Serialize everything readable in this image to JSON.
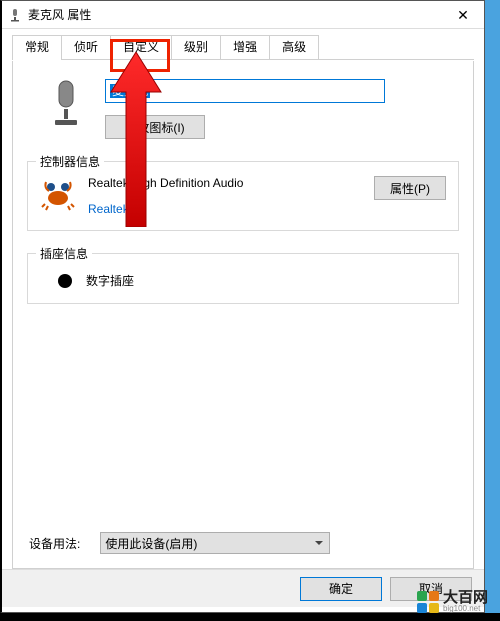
{
  "window": {
    "title": "麦克风 属性",
    "close": "✕"
  },
  "tabs": {
    "t0": "常规",
    "t1": "侦听",
    "t2": "自定义",
    "t3": "级别",
    "t4": "增强",
    "t5": "高级"
  },
  "device_name": "麦克风",
  "change_icon_btn": "更改图标(I)",
  "controller": {
    "legend": "控制器信息",
    "name": "Realtek High Definition Audio",
    "vendor": "Realtek",
    "properties_btn": "属性(P)"
  },
  "jack": {
    "legend": "插座信息",
    "label": "数字插座"
  },
  "usage": {
    "label": "设备用法:",
    "selected": "使用此设备(启用)"
  },
  "footer": {
    "ok": "确定",
    "cancel": "取消"
  },
  "logo": {
    "name": "大百网",
    "url": "big100.net"
  },
  "colors": {
    "accent": "#0078d7",
    "highlight": "#e20"
  }
}
